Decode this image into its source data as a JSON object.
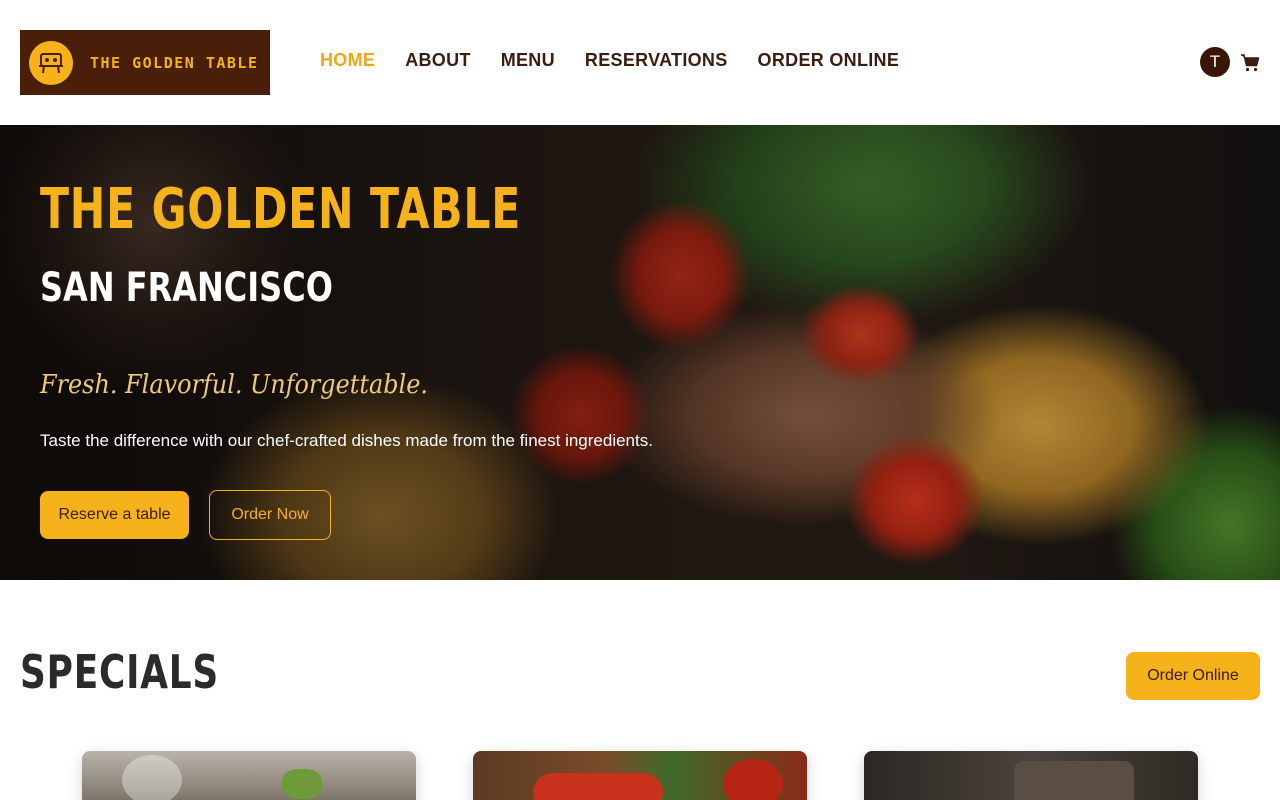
{
  "brand": {
    "logo_text": "THE GOLDEN TABLE",
    "accent_color": "#f6b21b",
    "dark_color": "#4a1f0a"
  },
  "nav": {
    "items": [
      {
        "label": "HOME",
        "active": true
      },
      {
        "label": "ABOUT",
        "active": false
      },
      {
        "label": "MENU",
        "active": false
      },
      {
        "label": "RESERVATIONS",
        "active": false
      },
      {
        "label": "ORDER ONLINE",
        "active": false
      }
    ]
  },
  "user": {
    "avatar_initial": "T",
    "cart_icon": "shopping-cart-icon"
  },
  "hero": {
    "title": "THE GOLDEN TABLE",
    "subtitle": "SAN FRANCISCO",
    "tagline": "Fresh. Flavorful. Unforgettable.",
    "description": "Taste the difference with our chef-crafted dishes made from the finest ingredients.",
    "primary_button": "Reserve a table",
    "secondary_button": "Order Now"
  },
  "specials": {
    "title": "SPECIALS",
    "order_button": "Order Online"
  }
}
